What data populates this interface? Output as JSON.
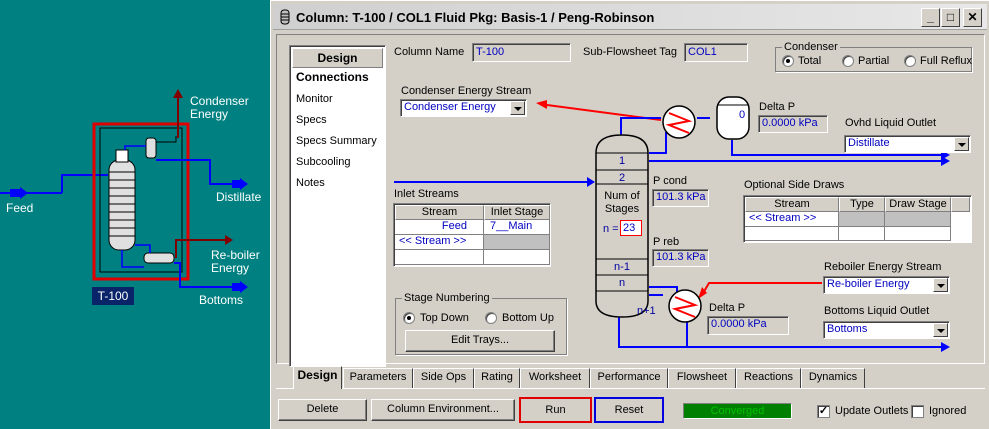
{
  "pfd": {
    "labels": {
      "feed": "Feed",
      "distillate": "Distillate",
      "bottoms": "Bottoms",
      "condenser_energy": "Condenser Energy",
      "reboiler_energy": "Re-boiler Energy"
    },
    "unit_tag": "T-100"
  },
  "window": {
    "title": "Column: T-100 / COL1  Fluid Pkg: Basis-1 / Peng-Robinson",
    "buttons": {
      "minimize": "_",
      "maximize": "□",
      "close": "✕"
    }
  },
  "sidebar": {
    "header": "Design",
    "items": [
      {
        "label": "Connections",
        "active": true
      },
      {
        "label": "Monitor"
      },
      {
        "label": "Specs"
      },
      {
        "label": "Specs Summary"
      },
      {
        "label": "Subcooling"
      },
      {
        "label": "Notes"
      }
    ]
  },
  "form": {
    "column_name_label": "Column Name",
    "column_name": "T-100",
    "subflowsheet_label": "Sub-Flowsheet Tag",
    "subflowsheet": "COL1",
    "condenser_group": "Condenser",
    "condenser_options": [
      "Total",
      "Partial",
      "Full Reflux"
    ],
    "condenser_selected": "Total",
    "condenser_energy_label": "Condenser Energy Stream",
    "condenser_energy_value": "Condenser Energy",
    "delta_p_label": "Delta P",
    "delta_p_top": "0.0000 kPa",
    "ovhd_label": "Ovhd Liquid Outlet",
    "ovhd_value": "Distillate",
    "condenser_vessel_value": "0",
    "pcond_label": "P cond",
    "pcond_value": "101.3 kPa",
    "preb_label": "P reb",
    "preb_value": "101.3 kPa",
    "inlet_streams_label": "Inlet Streams",
    "inlet_headers": [
      "Stream",
      "Inlet Stage"
    ],
    "inlet_rows": [
      {
        "stream": "Feed",
        "stage": "7__Main"
      },
      {
        "stream": "<< Stream >>",
        "stage": ""
      }
    ],
    "side_draws_label": "Optional Side Draws",
    "side_headers": [
      "Stream",
      "Type",
      "Draw Stage"
    ],
    "side_rows": [
      {
        "stream": "<< Stream >>",
        "type": "",
        "stage": ""
      }
    ],
    "stages": {
      "s1": "1",
      "s2": "2",
      "num_of": "Num of",
      "stages_word": "Stages",
      "n_eq": "n =",
      "n_value": "23",
      "n_minus_1": "n-1",
      "n": "n",
      "n_plus_1": "n+1"
    },
    "reboiler_energy_label": "Reboiler Energy Stream",
    "reboiler_energy_value": "Re-boiler Energy",
    "delta_p_bottom": "0.0000 kPa",
    "bottoms_label": "Bottoms Liquid Outlet",
    "bottoms_value": "Bottoms",
    "stage_numbering_label": "Stage Numbering",
    "stage_numbering_options": [
      "Top Down",
      "Bottom Up"
    ],
    "stage_numbering_selected": "Top Down",
    "edit_trays": "Edit Trays..."
  },
  "tabs": [
    "Design",
    "Parameters",
    "Side Ops",
    "Rating",
    "Worksheet",
    "Performance",
    "Flowsheet",
    "Reactions",
    "Dynamics"
  ],
  "active_tab": "Design",
  "footer": {
    "delete": "Delete",
    "column_env": "Column Environment...",
    "run": "Run",
    "reset": "Reset",
    "status": "Converged",
    "update_outlets": "Update Outlets",
    "update_outlets_checked": true,
    "ignored": "Ignored",
    "ignored_checked": false
  },
  "colors": {
    "background": "#008080",
    "window": "#d4d0c8",
    "stream_blue": "#0000ff",
    "energy_red": "#ff0000",
    "highlight_red": "#e00000",
    "status_green": "#008000"
  }
}
